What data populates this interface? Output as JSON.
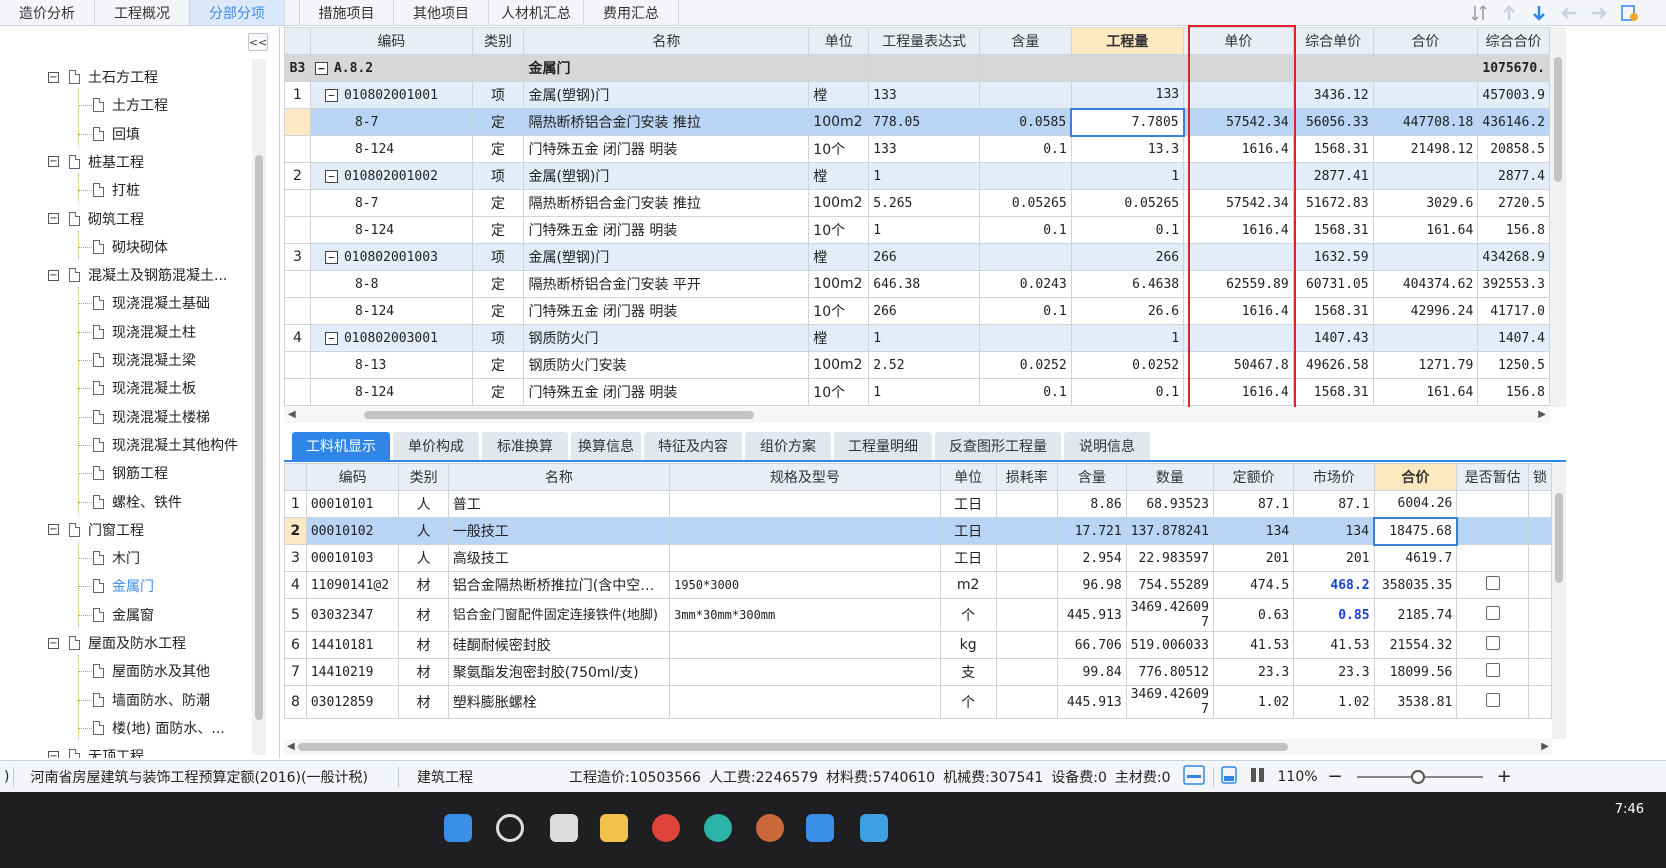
{
  "top_tabs": [
    "造价分析",
    "工程概况",
    "分部分项",
    "措施项目",
    "其他项目",
    "人材机汇总",
    "费用汇总"
  ],
  "active_top_tab": "分部分项",
  "tree": {
    "collapse_label": "<<",
    "items": [
      {
        "label": "土石方工程",
        "level": 0,
        "exp": "−"
      },
      {
        "label": "土方工程",
        "level": 1
      },
      {
        "label": "回填",
        "level": 1
      },
      {
        "label": "桩基工程",
        "level": 0,
        "exp": "−"
      },
      {
        "label": "打桩",
        "level": 1
      },
      {
        "label": "砌筑工程",
        "level": 0,
        "exp": "−"
      },
      {
        "label": "砌块砌体",
        "level": 1
      },
      {
        "label": "混凝土及钢筋混凝土...",
        "level": 0,
        "exp": "−"
      },
      {
        "label": "现浇混凝土基础",
        "level": 1
      },
      {
        "label": "现浇混凝土柱",
        "level": 1
      },
      {
        "label": "现浇混凝土梁",
        "level": 1
      },
      {
        "label": "现浇混凝土板",
        "level": 1
      },
      {
        "label": "现浇混凝土楼梯",
        "level": 1
      },
      {
        "label": "现浇混凝土其他构件",
        "level": 1
      },
      {
        "label": "钢筋工程",
        "level": 1
      },
      {
        "label": "螺栓、铁件",
        "level": 1
      },
      {
        "label": "门窗工程",
        "level": 0,
        "exp": "−"
      },
      {
        "label": "木门",
        "level": 1
      },
      {
        "label": "金属门",
        "level": 1,
        "active": true
      },
      {
        "label": "金属窗",
        "level": 1
      },
      {
        "label": "屋面及防水工程",
        "level": 0,
        "exp": "−"
      },
      {
        "label": "屋面防水及其他",
        "level": 1
      },
      {
        "label": "墙面防水、防潮",
        "level": 1
      },
      {
        "label": "楼(地) 面防水、...",
        "level": 1
      },
      {
        "label": "无顶工程",
        "level": 0,
        "exp": "−"
      }
    ]
  },
  "upper_grid": {
    "headers": [
      "",
      "编码",
      "类别",
      "名称",
      "单位",
      "工程量表达式",
      "含量",
      "工程量",
      "单价",
      "综合单价",
      "合价",
      "综合合价"
    ],
    "section": {
      "row_label": "B3",
      "code": "A.8.2",
      "name": "金属门",
      "total": "1075670."
    },
    "rows": [
      {
        "no": "1",
        "kind": "item",
        "code": "010802001001",
        "type": "项",
        "name": "金属(塑钢)门",
        "unit": "樘",
        "expr": "133",
        "content": "",
        "qty": "133",
        "price": "",
        "comp_price": "3436.12",
        "amount": "",
        "comp_amount": "457003.9"
      },
      {
        "no": "",
        "kind": "sel",
        "code": "8-7",
        "type": "定",
        "name": "隔热断桥铝合金门安装 推拉",
        "unit": "100m2",
        "expr": "778.05",
        "content": "0.0585",
        "qty": "7.7805",
        "price": "57542.34",
        "comp_price": "56056.33",
        "amount": "447708.18",
        "comp_amount": "436146.2"
      },
      {
        "no": "",
        "kind": "sub",
        "code": "8-124",
        "type": "定",
        "name": "门特殊五金 闭门器 明装",
        "unit": "10个",
        "expr": "133",
        "content": "0.1",
        "qty": "13.3",
        "price": "1616.4",
        "comp_price": "1568.31",
        "amount": "21498.12",
        "comp_amount": "20858.5"
      },
      {
        "no": "2",
        "kind": "item",
        "code": "010802001002",
        "type": "项",
        "name": "金属(塑钢)门",
        "unit": "樘",
        "expr": "1",
        "content": "",
        "qty": "1",
        "price": "",
        "comp_price": "2877.41",
        "amount": "",
        "comp_amount": "2877.4"
      },
      {
        "no": "",
        "kind": "sub",
        "code": "8-7",
        "type": "定",
        "name": "隔热断桥铝合金门安装 推拉",
        "unit": "100m2",
        "expr": "5.265",
        "content": "0.05265",
        "qty": "0.05265",
        "price": "57542.34",
        "comp_price": "51672.83",
        "amount": "3029.6",
        "comp_amount": "2720.5"
      },
      {
        "no": "",
        "kind": "sub",
        "code": "8-124",
        "type": "定",
        "name": "门特殊五金 闭门器 明装",
        "unit": "10个",
        "expr": "1",
        "content": "0.1",
        "qty": "0.1",
        "price": "1616.4",
        "comp_price": "1568.31",
        "amount": "161.64",
        "comp_amount": "156.8"
      },
      {
        "no": "3",
        "kind": "item",
        "code": "010802001003",
        "type": "项",
        "name": "金属(塑钢)门",
        "unit": "樘",
        "expr": "266",
        "content": "",
        "qty": "266",
        "price": "",
        "comp_price": "1632.59",
        "amount": "",
        "comp_amount": "434268.9"
      },
      {
        "no": "",
        "kind": "sub",
        "code": "8-8",
        "type": "定",
        "name": "隔热断桥铝合金门安装 平开",
        "unit": "100m2",
        "expr": "646.38",
        "content": "0.0243",
        "qty": "6.4638",
        "price": "62559.89",
        "comp_price": "60731.05",
        "amount": "404374.62",
        "comp_amount": "392553.3"
      },
      {
        "no": "",
        "kind": "sub",
        "code": "8-124",
        "type": "定",
        "name": "门特殊五金 闭门器 明装",
        "unit": "10个",
        "expr": "266",
        "content": "0.1",
        "qty": "26.6",
        "price": "1616.4",
        "comp_price": "1568.31",
        "amount": "42996.24",
        "comp_amount": "41717.0"
      },
      {
        "no": "4",
        "kind": "item",
        "code": "010802003001",
        "type": "项",
        "name": "钢质防火门",
        "unit": "樘",
        "expr": "1",
        "content": "",
        "qty": "1",
        "price": "",
        "comp_price": "1407.43",
        "amount": "",
        "comp_amount": "1407.4"
      },
      {
        "no": "",
        "kind": "sub",
        "code": "8-13",
        "type": "定",
        "name": "钢质防火门安装",
        "unit": "100m2",
        "expr": "2.52",
        "content": "0.0252",
        "qty": "0.0252",
        "price": "50467.8",
        "comp_price": "49626.58",
        "amount": "1271.79",
        "comp_amount": "1250.5"
      },
      {
        "no": "",
        "kind": "sub",
        "code": "8-124",
        "type": "定",
        "name": "门特殊五金 闭门器 明装",
        "unit": "10个",
        "expr": "1",
        "content": "0.1",
        "qty": "0.1",
        "price": "1616.4",
        "comp_price": "1568.31",
        "amount": "161.64",
        "comp_amount": "156.8"
      }
    ]
  },
  "lower_tabs": [
    "工料机显示",
    "单价构成",
    "标准换算",
    "换算信息",
    "特征及内容",
    "组价方案",
    "工程量明细",
    "反查图形工程量",
    "说明信息"
  ],
  "active_lower_tab": "工料机显示",
  "lower_grid": {
    "headers": [
      "",
      "编码",
      "类别",
      "名称",
      "规格及型号",
      "单位",
      "损耗率",
      "含量",
      "数量",
      "定额价",
      "市场价",
      "合价",
      "是否暂估",
      "锁"
    ],
    "rows": [
      {
        "no": "1",
        "code": "00010101",
        "type": "人",
        "name": "普工",
        "spec": "",
        "unit": "工日",
        "loss": "",
        "content": "8.86",
        "qty": "68.93523",
        "quota": "87.1",
        "market": "87.1",
        "amount": "6004.26",
        "check": false
      },
      {
        "no": "2",
        "code": "00010102",
        "type": "人",
        "name": "一般技工",
        "spec": "",
        "unit": "工日",
        "loss": "",
        "content": "17.721",
        "qty": "137.878241",
        "quota": "134",
        "market": "134",
        "amount": "18475.68",
        "check": false,
        "sel": true
      },
      {
        "no": "3",
        "code": "00010103",
        "type": "人",
        "name": "高级技工",
        "spec": "",
        "unit": "工日",
        "loss": "",
        "content": "2.954",
        "qty": "22.983597",
        "quota": "201",
        "market": "201",
        "amount": "4619.7",
        "check": false
      },
      {
        "no": "4",
        "code": "11090141@2",
        "type": "材",
        "name": "铝合金隔热断桥推拉门(含中空…",
        "spec": "1950*3000",
        "unit": "m2",
        "loss": "",
        "content": "96.98",
        "qty": "754.55289",
        "quota": "474.5",
        "market": "468.2",
        "amount": "358035.35",
        "check": true,
        "blue": true
      },
      {
        "no": "5",
        "code": "03032347",
        "type": "材",
        "name": "铝合金门窗配件固定连接铁件(地脚)",
        "spec": "3mm*30mm*300mm",
        "unit": "个",
        "loss": "",
        "content": "445.913",
        "qty": "3469.426097",
        "quota": "0.63",
        "market": "0.85",
        "amount": "2185.74",
        "check": true,
        "blue": true
      },
      {
        "no": "6",
        "code": "14410181",
        "type": "材",
        "name": "硅酮耐候密封胶",
        "spec": "",
        "unit": "kg",
        "loss": "",
        "content": "66.706",
        "qty": "519.006033",
        "quota": "41.53",
        "market": "41.53",
        "amount": "21554.32",
        "check": true
      },
      {
        "no": "7",
        "code": "14410219",
        "type": "材",
        "name": "聚氨酯发泡密封胶(750ml/支)",
        "spec": "",
        "unit": "支",
        "loss": "",
        "content": "99.84",
        "qty": "776.80512",
        "quota": "23.3",
        "market": "23.3",
        "amount": "18099.56",
        "check": true
      },
      {
        "no": "8",
        "code": "03012859",
        "type": "材",
        "name": "塑料膨胀螺栓",
        "spec": "",
        "unit": "个",
        "loss": "",
        "content": "445.913",
        "qty": "3469.426097",
        "quota": "1.02",
        "market": "1.02",
        "amount": "3538.81",
        "check": true
      }
    ]
  },
  "status_bar": {
    "left": ")",
    "quota_lib": "河南省房屋建筑与装饰工程预算定额(2016)(一般计税)",
    "project_type": "建筑工程",
    "cost_total": "工程造价:10503566",
    "labor": "人工费:2246579",
    "material": "材料费:5740610",
    "machine": "机械费:307541",
    "equipment": "设备费:0",
    "main_material": "主材费:0",
    "zoom": "110%"
  },
  "taskbar": {
    "clock": "7:46"
  },
  "colors": {
    "accent": "#2f86e8",
    "highlight_box": "#e0202a",
    "selected_row": "#b9d4f4",
    "item_row": "#e3ecf9"
  }
}
